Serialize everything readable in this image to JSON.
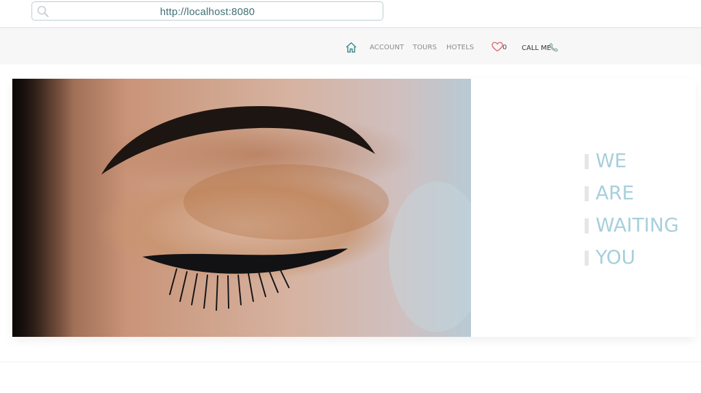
{
  "browser": {
    "url": "http://localhost:8080",
    "search_icon": "search-icon"
  },
  "nav": {
    "home_icon": "home-icon",
    "items": [
      {
        "label": "ACCOUNT"
      },
      {
        "label": "TOURS"
      },
      {
        "label": "HOTELS"
      }
    ],
    "favorites_icon": "heart-icon",
    "favorites_count": "0",
    "call_label": "CALL ME",
    "phone_icon": "phone-icon"
  },
  "hero": {
    "image": "closed-eye-makeup-photo",
    "tagline": [
      "WE",
      "ARE",
      "WAITING",
      "YOU"
    ]
  },
  "colors": {
    "accent": "#a7cfdc",
    "home_icon": "#3d8a8a",
    "heart": "#d9636b",
    "url_text": "#3f6f74"
  }
}
